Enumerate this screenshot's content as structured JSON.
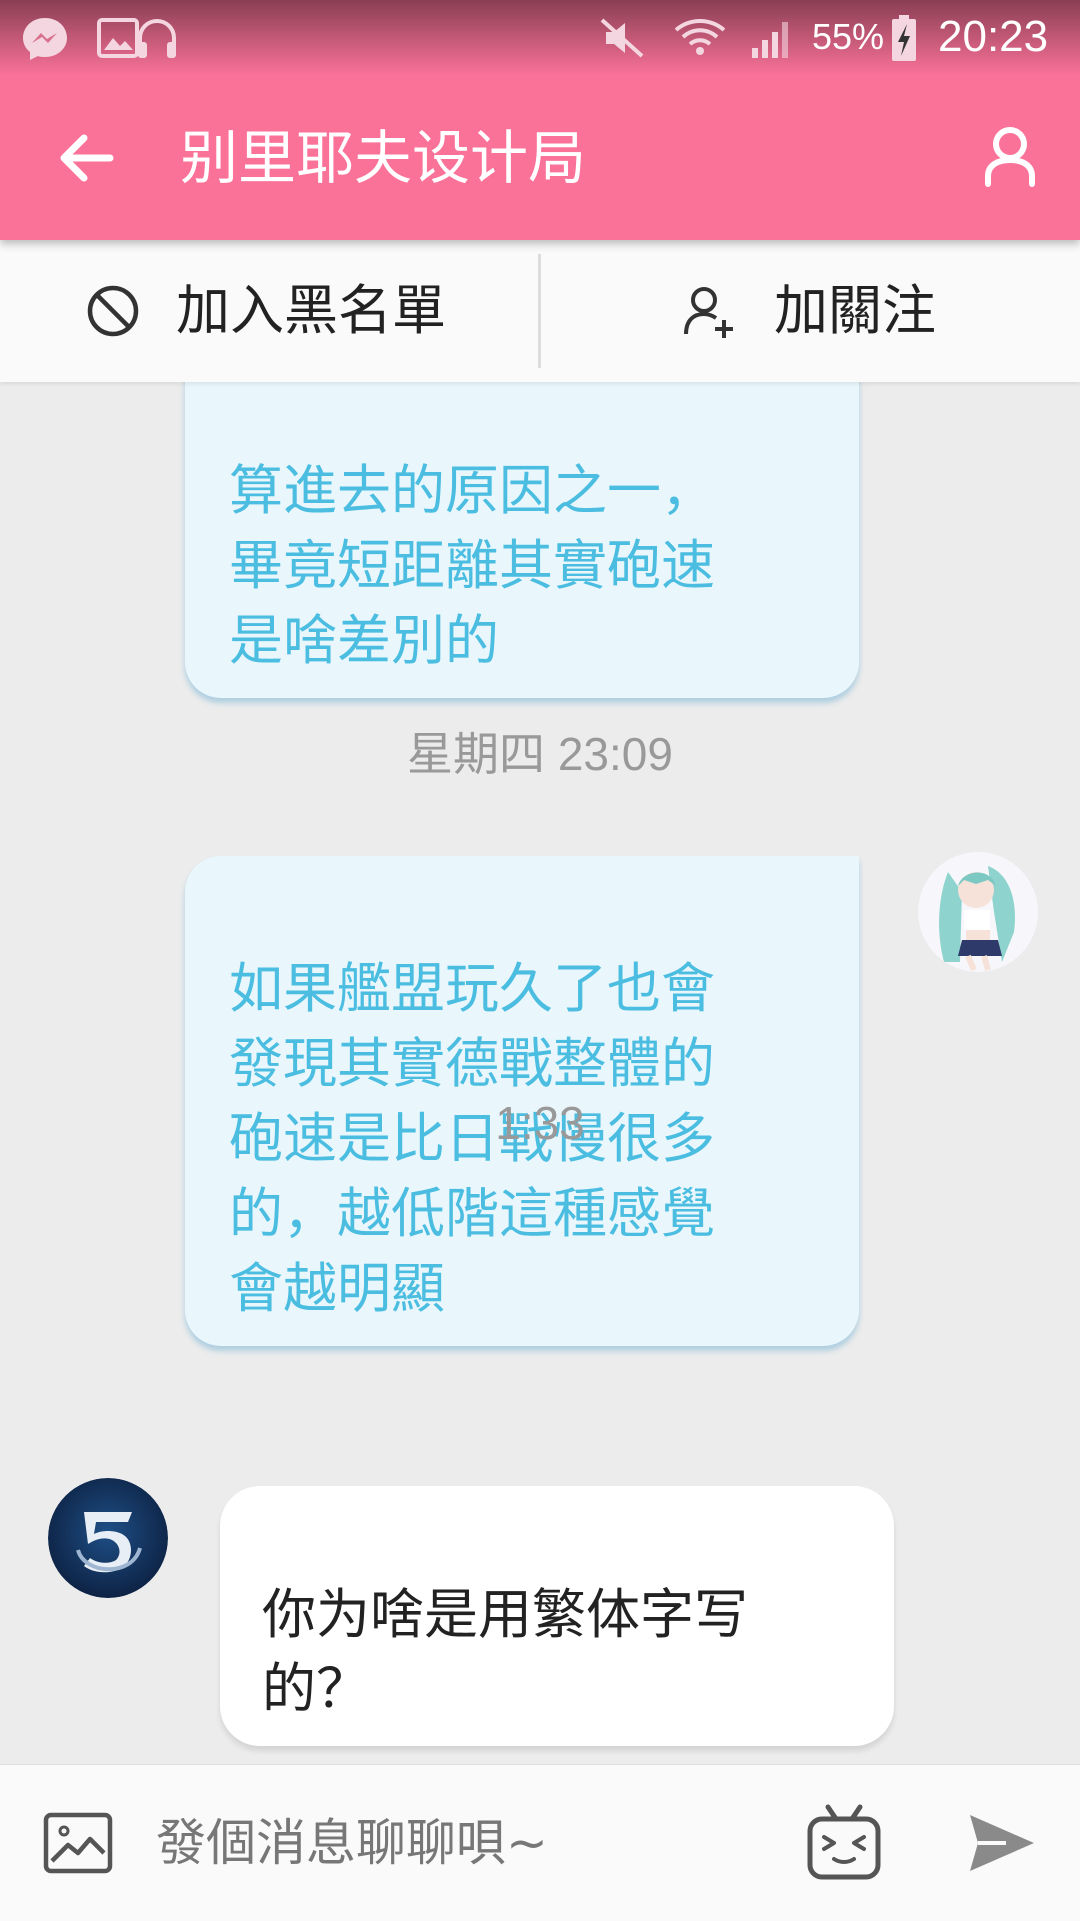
{
  "status_bar": {
    "battery": "55%",
    "time": "20:23"
  },
  "app_bar": {
    "title": "别里耶夫设计局"
  },
  "actions": {
    "block_label": "加入黑名單",
    "follow_label": "加關注"
  },
  "messages": {
    "partial_self": "算進去的原因之一，\n畢竟短距離其實砲速\n是啥差別的",
    "ts1": "星期四 23:09",
    "self_msg": "如果艦盟玩久了也會\n發現其實德戰整體的\n砲速是比日戰慢很多\n的，越低階這種感覺\n會越明顯",
    "ts2": "1:33",
    "other_msg": "你为啥是用繁体字写\n的？"
  },
  "input": {
    "placeholder": "發個消息聊聊唄~",
    "value": ""
  },
  "colors": {
    "accent": "#fb7299",
    "self_text": "#4bbde0",
    "self_bubble": "#e9f7fd"
  },
  "icons": {
    "back": "arrow-left-icon",
    "profile": "user-icon",
    "block": "block-icon",
    "follow": "add-user-icon",
    "image": "image-icon",
    "emoji": "tv-face-icon",
    "send": "send-icon"
  }
}
